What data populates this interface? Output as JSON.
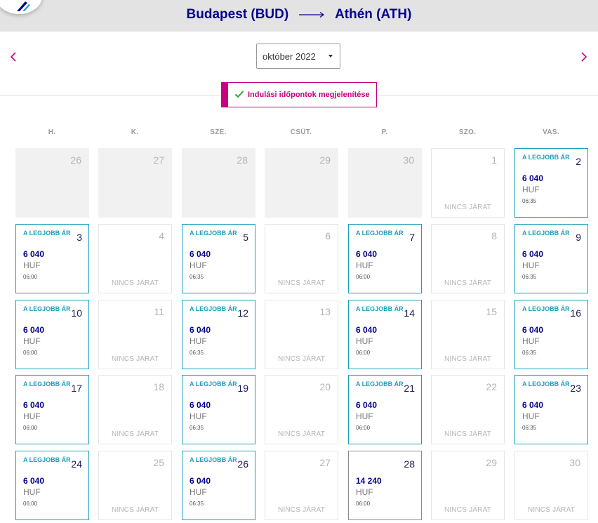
{
  "route": {
    "origin": "Budapest (BUD)",
    "destination": "Athén (ATH)"
  },
  "month_select": {
    "value": "október 2022"
  },
  "toggle_label": "Indulási időpontok megjelenítése",
  "weekdays": [
    "H.",
    "K.",
    "SZE.",
    "CSÜT.",
    "P.",
    "SZO.",
    "VAS."
  ],
  "colors": {
    "brand_navy": "#06038d",
    "accent_magenta": "#c6007e",
    "best_price_teal": "#1e9fbd"
  },
  "icons": {
    "logo": "airline-logo-icon",
    "prev": "chevron-left-icon",
    "next": "chevron-right-icon",
    "toggle": "checkmark-icon"
  },
  "days": [
    {
      "day": "26",
      "state": "past"
    },
    {
      "day": "27",
      "state": "past"
    },
    {
      "day": "28",
      "state": "past"
    },
    {
      "day": "29",
      "state": "past"
    },
    {
      "day": "30",
      "state": "past"
    },
    {
      "day": "1",
      "state": "none",
      "note": "NINCS JÁRAT"
    },
    {
      "day": "2",
      "state": "best",
      "badge": "A LEGJOBB ÁR",
      "price": "6 040",
      "currency": "HUF",
      "time": "06:35"
    },
    {
      "day": "3",
      "state": "best",
      "badge": "A LEGJOBB ÁR",
      "price": "6 040",
      "currency": "HUF",
      "time": "06:00"
    },
    {
      "day": "4",
      "state": "none",
      "note": "NINCS JÁRAT"
    },
    {
      "day": "5",
      "state": "best",
      "badge": "A LEGJOBB ÁR",
      "price": "6 040",
      "currency": "HUF",
      "time": "06:35"
    },
    {
      "day": "6",
      "state": "none",
      "note": "NINCS JÁRAT"
    },
    {
      "day": "7",
      "state": "best",
      "badge": "A LEGJOBB ÁR",
      "price": "6 040",
      "currency": "HUF",
      "time": "06:00"
    },
    {
      "day": "8",
      "state": "none",
      "note": "NINCS JÁRAT"
    },
    {
      "day": "9",
      "state": "best",
      "badge": "A LEGJOBB ÁR",
      "price": "6 040",
      "currency": "HUF",
      "time": "06:35"
    },
    {
      "day": "10",
      "state": "best",
      "badge": "A LEGJOBB ÁR",
      "price": "6 040",
      "currency": "HUF",
      "time": "06:00"
    },
    {
      "day": "11",
      "state": "none",
      "note": "NINCS JÁRAT"
    },
    {
      "day": "12",
      "state": "best",
      "badge": "A LEGJOBB ÁR",
      "price": "6 040",
      "currency": "HUF",
      "time": "06:35"
    },
    {
      "day": "13",
      "state": "none",
      "note": "NINCS JÁRAT"
    },
    {
      "day": "14",
      "state": "best",
      "badge": "A LEGJOBB ÁR",
      "price": "6 040",
      "currency": "HUF",
      "time": "06:00"
    },
    {
      "day": "15",
      "state": "none",
      "note": "NINCS JÁRAT"
    },
    {
      "day": "16",
      "state": "best",
      "badge": "A LEGJOBB ÁR",
      "price": "6 040",
      "currency": "HUF",
      "time": "06:35"
    },
    {
      "day": "17",
      "state": "best",
      "badge": "A LEGJOBB ÁR",
      "price": "6 040",
      "currency": "HUF",
      "time": "06:00"
    },
    {
      "day": "18",
      "state": "none",
      "note": "NINCS JÁRAT"
    },
    {
      "day": "19",
      "state": "best",
      "badge": "A LEGJOBB ÁR",
      "price": "6 040",
      "currency": "HUF",
      "time": "06:35"
    },
    {
      "day": "20",
      "state": "none",
      "note": "NINCS JÁRAT"
    },
    {
      "day": "21",
      "state": "best",
      "badge": "A LEGJOBB ÁR",
      "price": "6 040",
      "currency": "HUF",
      "time": "06:00"
    },
    {
      "day": "22",
      "state": "none",
      "note": "NINCS JÁRAT"
    },
    {
      "day": "23",
      "state": "best",
      "badge": "A LEGJOBB ÁR",
      "price": "6 040",
      "currency": "HUF",
      "time": "06:35"
    },
    {
      "day": "24",
      "state": "best",
      "badge": "A LEGJOBB ÁR",
      "price": "6 040",
      "currency": "HUF",
      "time": "06:00"
    },
    {
      "day": "25",
      "state": "none",
      "note": "NINCS JÁRAT"
    },
    {
      "day": "26",
      "state": "best",
      "badge": "A LEGJOBB ÁR",
      "price": "6 040",
      "currency": "HUF",
      "time": "06:35"
    },
    {
      "day": "27",
      "state": "none",
      "note": "NINCS JÁRAT"
    },
    {
      "day": "28",
      "state": "avail",
      "price": "14 240",
      "currency": "HUF",
      "time": "06:00"
    },
    {
      "day": "29",
      "state": "none",
      "note": "NINCS JÁRAT"
    },
    {
      "day": "30",
      "state": "none",
      "note": "NINCS JÁRAT"
    }
  ]
}
